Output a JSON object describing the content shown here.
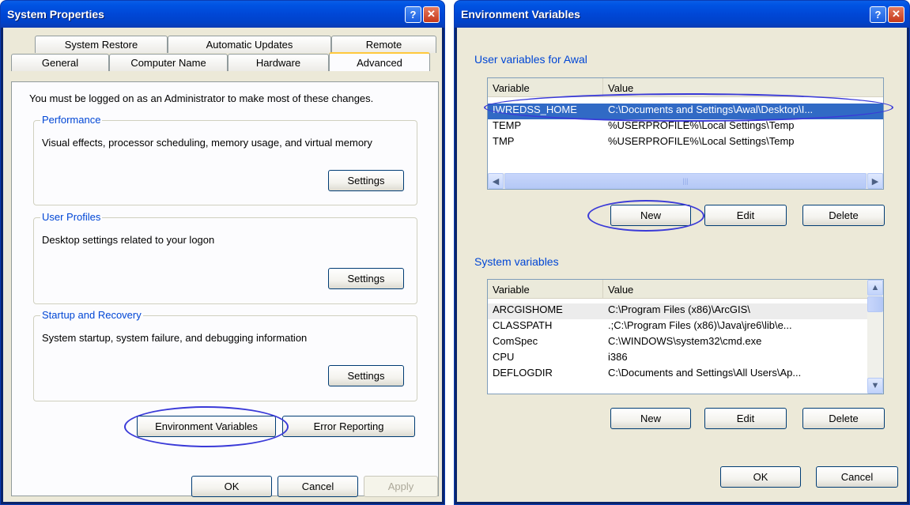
{
  "system_properties": {
    "title": "System Properties",
    "help_button": "?",
    "close_button": "✕",
    "tabs_row1": [
      "System Restore",
      "Automatic Updates",
      "Remote"
    ],
    "tabs_row2": [
      "General",
      "Computer Name",
      "Hardware",
      "Advanced"
    ],
    "active_tab": "Advanced",
    "admin_note": "You must be logged on as an Administrator to make most of these changes.",
    "performance": {
      "title": "Performance",
      "description": "Visual effects, processor scheduling, memory usage, and virtual memory",
      "button": "Settings"
    },
    "user_profiles": {
      "title": "User Profiles",
      "description": "Desktop settings related to your logon",
      "button": "Settings"
    },
    "startup_recovery": {
      "title": "Startup and Recovery",
      "description": "System startup, system failure, and debugging information",
      "button": "Settings"
    },
    "env_vars_button": "Environment Variables",
    "error_reporting_button": "Error Reporting",
    "ok": "OK",
    "cancel": "Cancel",
    "apply": "Apply"
  },
  "environment_variables": {
    "title": "Environment Variables",
    "help_button": "?",
    "close_button": "✕",
    "user_section_label": "User variables for Awal",
    "user_columns": [
      "Variable",
      "Value"
    ],
    "user_rows": [
      {
        "variable": "IWREDSS_HOME",
        "value": "C:\\Documents and Settings\\Awal\\Desktop\\I..."
      },
      {
        "variable": "TEMP",
        "value": "%USERPROFILE%\\Local Settings\\Temp"
      },
      {
        "variable": "TMP",
        "value": "%USERPROFILE%\\Local Settings\\Temp"
      }
    ],
    "user_buttons": {
      "new": "New",
      "edit": "Edit",
      "delete": "Delete"
    },
    "system_section_label": "System variables",
    "system_columns": [
      "Variable",
      "Value"
    ],
    "system_rows": [
      {
        "variable": "ARCGISHOME",
        "value": "C:\\Program Files (x86)\\ArcGIS\\"
      },
      {
        "variable": "CLASSPATH",
        "value": ".;C:\\Program Files (x86)\\Java\\jre6\\lib\\e..."
      },
      {
        "variable": "ComSpec",
        "value": "C:\\WINDOWS\\system32\\cmd.exe"
      },
      {
        "variable": "CPU",
        "value": "i386"
      },
      {
        "variable": "DEFLOGDIR",
        "value": "C:\\Documents and Settings\\All Users\\Ap..."
      }
    ],
    "system_buttons": {
      "new": "New",
      "edit": "Edit",
      "delete": "Delete"
    },
    "ok": "OK",
    "cancel": "Cancel"
  },
  "colors": {
    "titlebar": "#0054e3",
    "dialog_bg": "#ece9d8",
    "group_title": "#0046d5",
    "annotation_circle": "#3a3ad8"
  }
}
